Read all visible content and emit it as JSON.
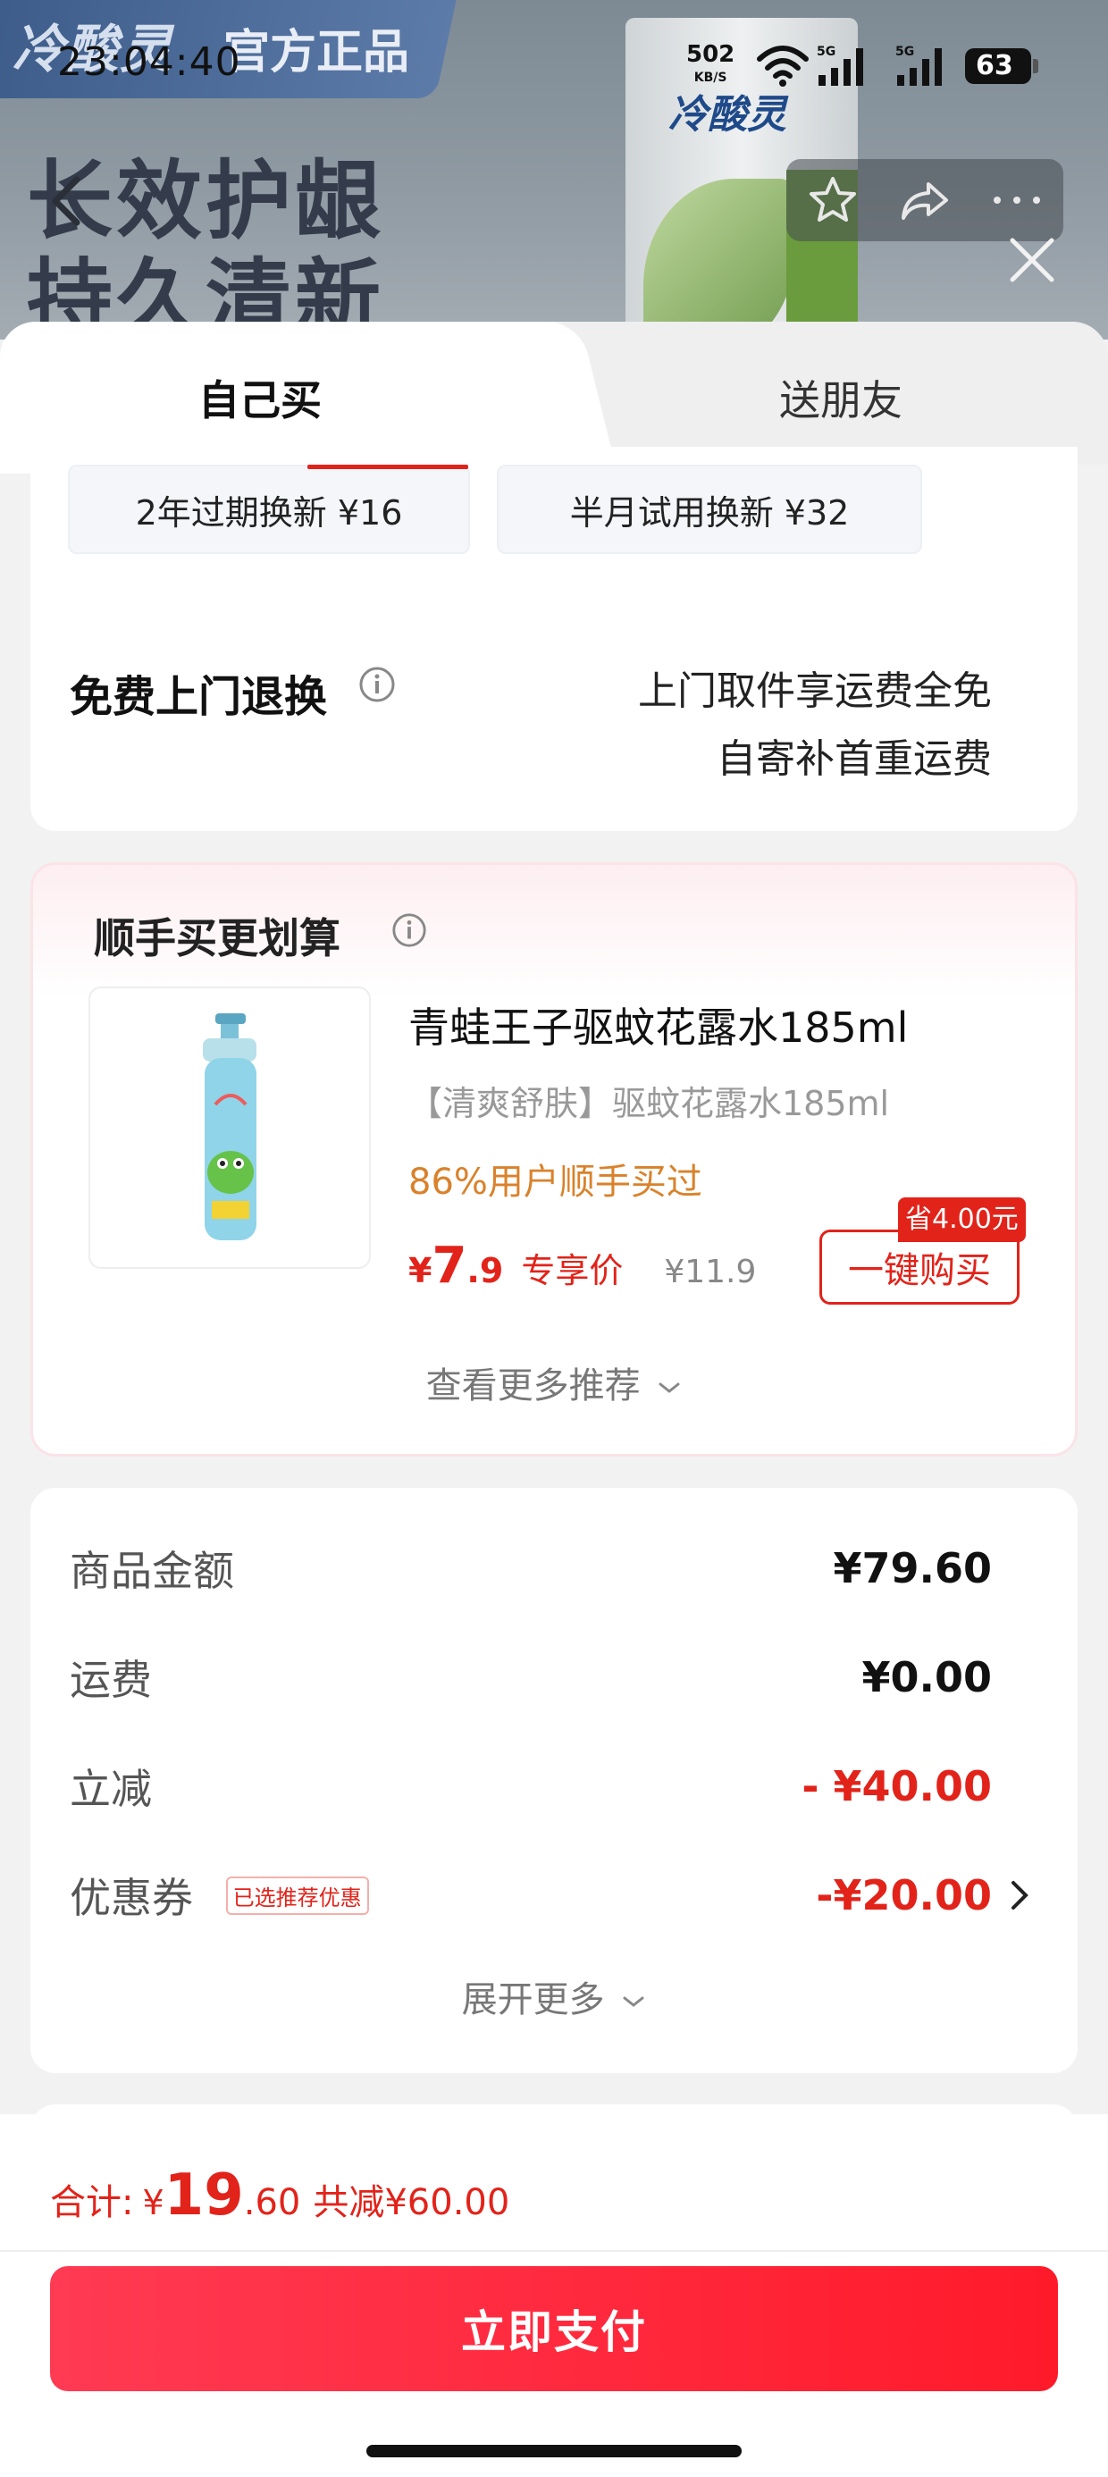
{
  "status_bar": {
    "time": "23:04:40",
    "net_speed": "502",
    "net_unit": "KB/S",
    "signal_1": "5G",
    "signal_2": "5G",
    "battery": "63"
  },
  "backdrop": {
    "brand": "冷酸灵",
    "banner_suffix": "官方正品",
    "slogan_line1": "长效护龈",
    "slogan_line2": "持久清新",
    "tube_brand": "冷酸灵"
  },
  "tabs": [
    {
      "label": "自己买",
      "active": true
    },
    {
      "label": "送朋友",
      "active": false
    }
  ],
  "service": {
    "options": [
      {
        "label": "2年过期换新  ¥16"
      },
      {
        "label": "半月试用换新  ¥32"
      }
    ],
    "free_return": {
      "title": "免费上门退换",
      "desc_line1": "上门取件享运费全免",
      "desc_line2": "自寄补首重运费"
    }
  },
  "bundle": {
    "title": "顺手买更划算",
    "product": {
      "name": "青蛙王子驱蚊花露水185ml",
      "subtitle": "【清爽舒肤】驱蚊花露水185ml",
      "popularity": "86%用户顺手买过",
      "price_currency": "¥",
      "price_int": "7",
      "price_dec": ".9",
      "price_tag": "专享价",
      "original_price": "¥11.9",
      "save_badge": "省4.00元",
      "buy_label": "一键购买",
      "image_label": "青蛙王子"
    },
    "more_label": "查看更多推荐"
  },
  "amounts": {
    "rows": [
      {
        "label": "商品金额",
        "value": "¥79.60",
        "red": false
      },
      {
        "label": "运费",
        "value": "¥0.00",
        "red": false
      },
      {
        "label": "立减",
        "value": "- ¥40.00",
        "red": true
      },
      {
        "label": "优惠券",
        "value": "-¥20.00",
        "red": true,
        "tag": "已选推荐优惠"
      }
    ],
    "expand_label": "展开更多"
  },
  "footer": {
    "total_label": "合计:",
    "total_currency": "¥",
    "total_int": "19",
    "total_dec": ".60",
    "total_saved": "共减¥60.00",
    "pay_label": "立即支付"
  },
  "colors": {
    "accent_red": "#e2231a",
    "pay_gradient_start": "#ff3a53",
    "pay_gradient_end": "#ff1a2a",
    "popular_orange": "#d9822b"
  },
  "icons": [
    "back-arrow-icon",
    "star-icon",
    "share-icon",
    "more-icon",
    "close-icon",
    "info-icon",
    "chevron-down-icon",
    "chevron-right-icon",
    "wifi-icon",
    "signal-icon"
  ]
}
